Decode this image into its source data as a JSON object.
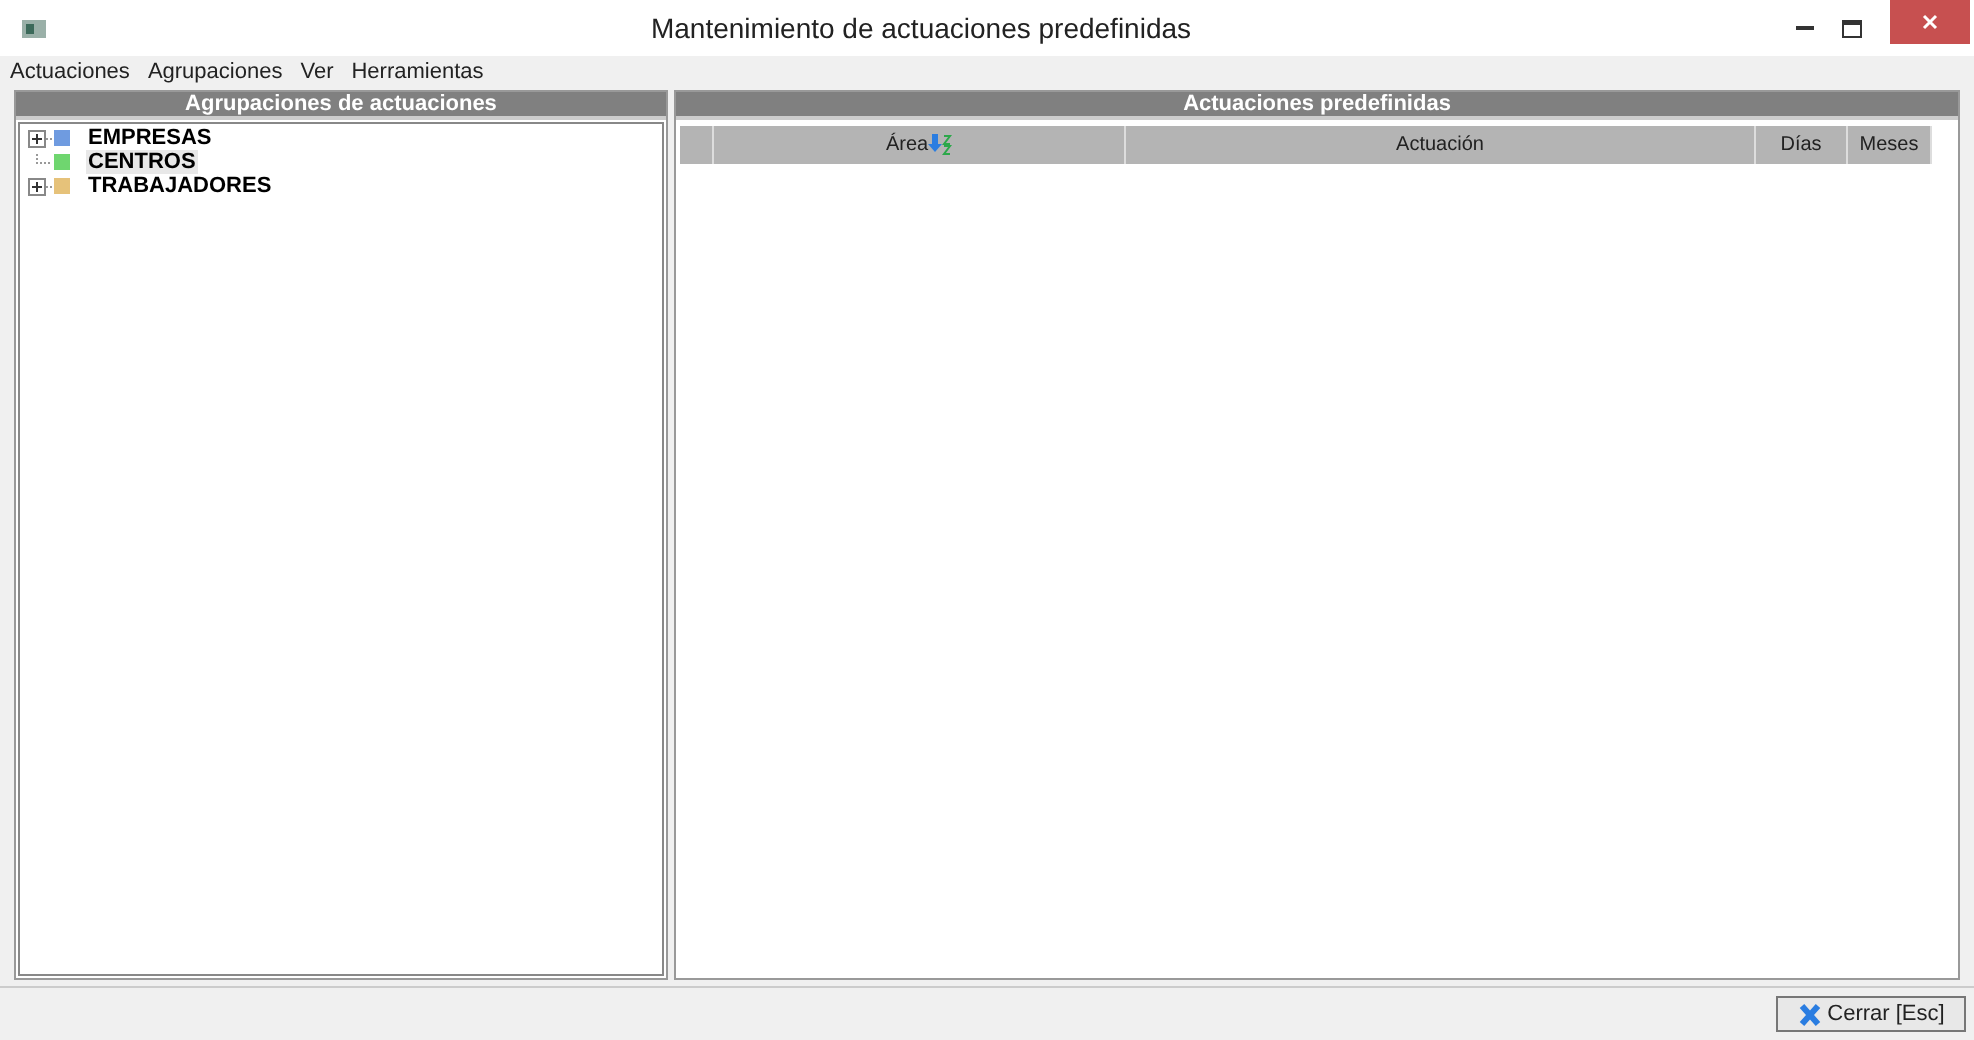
{
  "window": {
    "title": "Mantenimiento de actuaciones predefinidas"
  },
  "menu": [
    "Actuaciones",
    "Agrupaciones",
    "Ver",
    "Herramientas"
  ],
  "left_panel": {
    "title": "Agrupaciones de actuaciones",
    "tree": [
      {
        "label": "EMPRESAS",
        "color": "#6f9be0",
        "kind": "expandable",
        "selected": false
      },
      {
        "label": "CENTROS",
        "color": "#6fd66f",
        "kind": "leaf",
        "selected": true
      },
      {
        "label": "TRABAJADORES",
        "color": "#e6c27a",
        "kind": "expandable",
        "selected": false
      }
    ]
  },
  "right_panel": {
    "title": "Actuaciones predefinidas",
    "table": {
      "columns": [
        {
          "label": "Área",
          "sorted": true
        },
        {
          "label": "Actuación",
          "sorted": false
        },
        {
          "label": "Días",
          "sorted": false
        },
        {
          "label": "Meses",
          "sorted": false
        }
      ]
    }
  },
  "footer": {
    "close_button": "Cerrar [Esc]"
  }
}
